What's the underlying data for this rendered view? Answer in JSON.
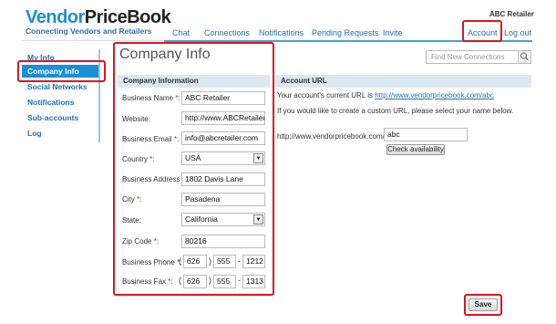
{
  "header": {
    "logo_vendor": "Vendor",
    "logo_pricebook": "PriceBook",
    "tagline": "Connecting Vendors and Retailers",
    "user_name": "ABC Retailer"
  },
  "nav": {
    "items": [
      "Chat",
      "Connections",
      "Notifications",
      "Pending Requests",
      "Invite",
      "Account",
      "Log out"
    ]
  },
  "sidebar": {
    "items": [
      "My Info",
      "Company Info",
      "Social Networks",
      "Notifications",
      "Sub-accounts",
      "Log"
    ],
    "active": "Company Info"
  },
  "page": {
    "title": "Company Info"
  },
  "company_info": {
    "section_title": "Company Information",
    "fields": {
      "business_name": {
        "label": "Business Name",
        "value": "ABC Retailer",
        "required": true
      },
      "website": {
        "label": "Website:",
        "value": "http://www.ABCRetailer.",
        "required": false
      },
      "business_email": {
        "label": "Business Email",
        "value": "info@abcretailer.com",
        "required": true
      },
      "country": {
        "label": "Country",
        "value": "USA",
        "required": true
      },
      "business_address": {
        "label": "Business Address",
        "value": "1802 Davis Lane",
        "required": true
      },
      "city": {
        "label": "City",
        "value": "Pasadena",
        "required": true
      },
      "state": {
        "label": "State:",
        "value": "California",
        "required": false
      },
      "zip": {
        "label": "Zip Code",
        "value": "80216",
        "required": true
      },
      "phone": {
        "label": "Business Phone",
        "area": "626",
        "prefix": "555",
        "line": "1212",
        "required": true
      },
      "fax": {
        "label": "Business Fax",
        "area": "626",
        "prefix": "555",
        "line": "1313",
        "required": true
      }
    },
    "required_mark": "*",
    "colon": ":"
  },
  "account_url": {
    "section_title": "Account URL",
    "current_text": "Your account's current URL is ",
    "current_url": "http://www.vendorpricebook.com/abc",
    "custom_text": "If you would like to create a custom URL, please select your name below.",
    "base_url": "http://www.vendorpricebook.com/",
    "custom_value": "abc",
    "check_button": "Check availability"
  },
  "search": {
    "placeholder": "Find New Connections"
  },
  "save_button": "Save",
  "colors": {
    "brand_blue": "#1b8fd8",
    "highlight_red": "#e0141c",
    "section_header_bg": "#dce9f3"
  }
}
